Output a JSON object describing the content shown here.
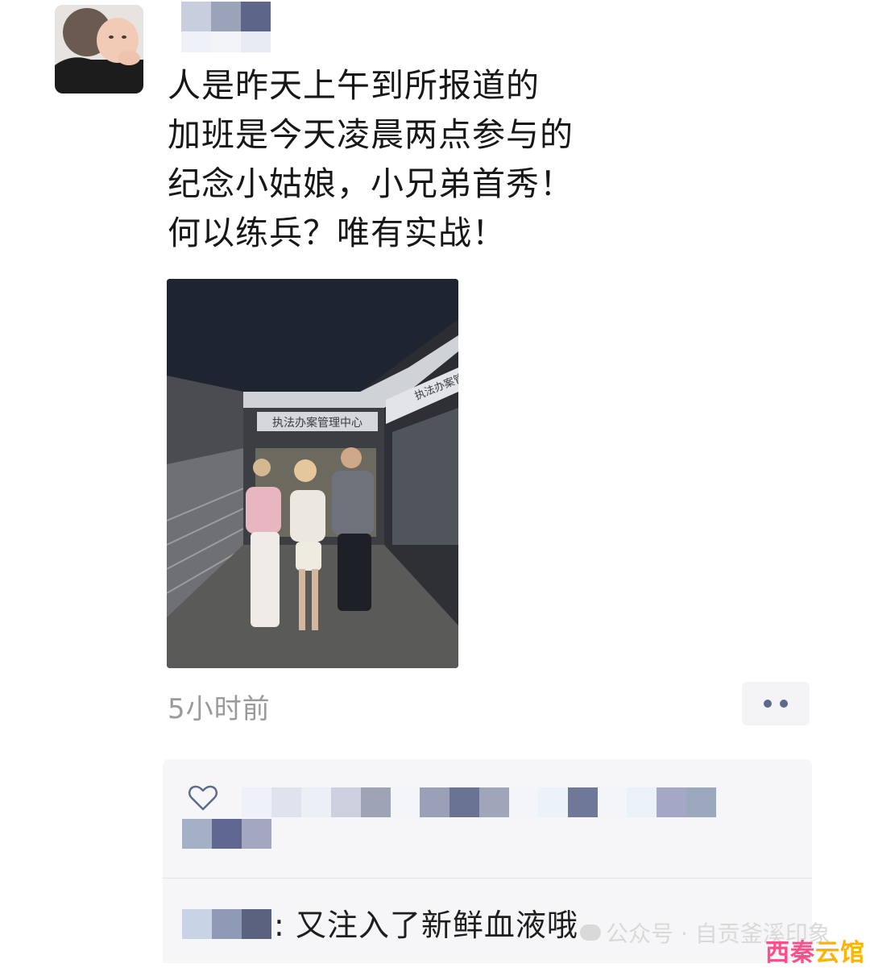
{
  "post": {
    "lines": [
      "人是昨天上午到所报道的",
      "加班是今天凌晨两点参与的",
      "纪念小姑娘，小兄弟首秀！",
      "何以练兵？唯有实战！"
    ],
    "time": "5小时前",
    "photo_sign_left": "执法办案管理中心",
    "photo_sign_right": "执法办案管理中"
  },
  "comments": {
    "items": [
      {
        "text": ": 又注入了新鲜血液哦"
      }
    ]
  },
  "watermark": {
    "text": "公众号 · 自贡釜溪印象",
    "logo_part1": "西秦",
    "logo_part2": "云馆"
  },
  "icons": {
    "like": "heart-outline-icon",
    "more": "more-dots-icon"
  },
  "colors": {
    "more_dots": "#5b6a8c",
    "time_text": "#9a9a9a",
    "logo_pink": "#ff4f8b",
    "logo_yellow": "#ffb300"
  }
}
